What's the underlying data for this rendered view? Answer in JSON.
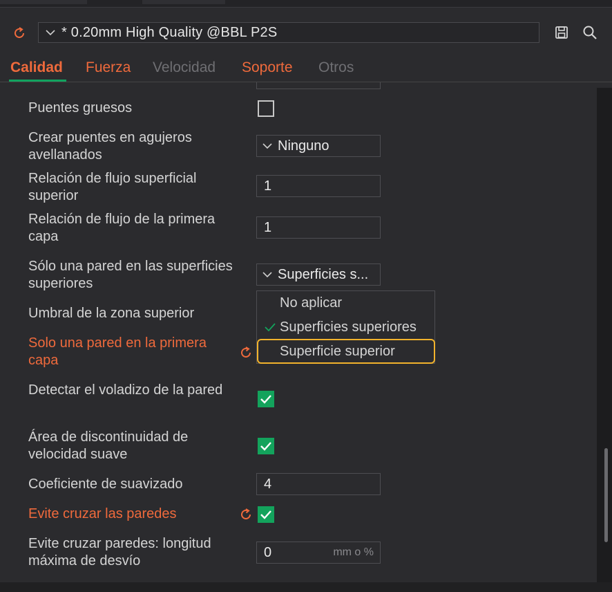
{
  "preset": {
    "name": "* 0.20mm High Quality @BBL P2S"
  },
  "tabs": [
    {
      "label": "Calidad",
      "state": "active"
    },
    {
      "label": "Fuerza",
      "state": "enabled"
    },
    {
      "label": "Velocidad",
      "state": "disabled"
    },
    {
      "label": "Soporte",
      "state": "enabled"
    },
    {
      "label": "Otros",
      "state": "disabled"
    }
  ],
  "settings": {
    "thick_bridges": {
      "label": "Puentes gruesos",
      "checked": false
    },
    "countersunk_bridges": {
      "label": "Crear puentes en agujeros avellanados",
      "value": "Ninguno"
    },
    "top_flow_ratio": {
      "label": "Relación de flujo superficial superior",
      "value": "1"
    },
    "first_layer_flow": {
      "label": "Relación de flujo de la primera capa",
      "value": "1"
    },
    "single_wall_top": {
      "label": "Sólo una pared en las superficies superiores",
      "value": "Superficies s..."
    },
    "top_area_threshold": {
      "label": "Umbral de la zona superior"
    },
    "single_wall_first": {
      "label": "Solo una pared en la primera capa",
      "modified": true
    },
    "detect_overhang": {
      "label": "Detectar el voladizo de la pared",
      "checked": true
    },
    "smooth_speed": {
      "label": "Área de discontinuidad de velocidad suave",
      "checked": true
    },
    "smooth_coef": {
      "label": "Coeficiente de suavizado",
      "value": "4"
    },
    "avoid_crossing": {
      "label": "Evite cruzar las paredes",
      "checked": true,
      "modified": true
    },
    "avoid_crossing_max": {
      "label": "Evite cruzar paredes: longitud máxima de desvío",
      "value": "0",
      "unit": "mm o %"
    }
  },
  "dropdown": {
    "options": [
      {
        "label": "No aplicar",
        "selected": false
      },
      {
        "label": "Superficies superiores",
        "selected": true
      },
      {
        "label": "Superficie superior",
        "selected": false,
        "highlighted": true
      }
    ]
  },
  "colors": {
    "accent_orange": "#ef6a3c",
    "check_green": "#13a35c",
    "highlight_yellow": "#f2b32c"
  }
}
